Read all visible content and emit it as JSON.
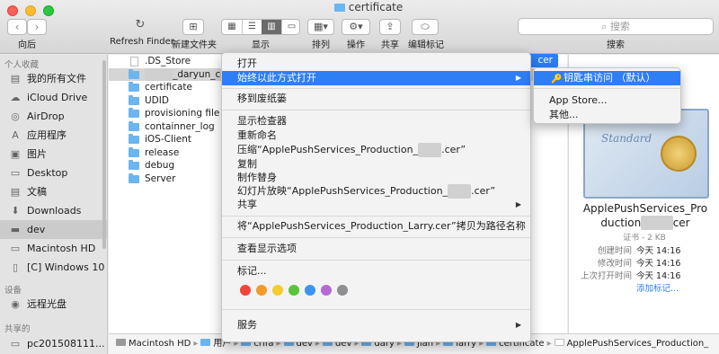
{
  "window": {
    "title": "certificate"
  },
  "toolbar": {
    "back_label": "向后",
    "refresh_label": "Refresh Finder",
    "newfolder_label": "新建文件夹",
    "view_label": "显示",
    "arrange_label": "排列",
    "action_label": "操作",
    "share_label": "共享",
    "tags_label": "编辑标记",
    "search_label": "搜索",
    "search_placeholder": "搜索"
  },
  "sidebar": {
    "personal_header": "个人收藏",
    "items": [
      {
        "label": "我的所有文件",
        "icon": "all-files-icon",
        "glyph": "▤"
      },
      {
        "label": "iCloud Drive",
        "icon": "cloud-icon",
        "glyph": "☁"
      },
      {
        "label": "AirDrop",
        "icon": "airdrop-icon",
        "glyph": "◎"
      },
      {
        "label": "应用程序",
        "icon": "applications-icon",
        "glyph": "A"
      },
      {
        "label": "图片",
        "icon": "pictures-icon",
        "glyph": "▣"
      },
      {
        "label": "Desktop",
        "icon": "desktop-icon",
        "glyph": "▭"
      },
      {
        "label": "文稿",
        "icon": "documents-icon",
        "glyph": "▤"
      },
      {
        "label": "Downloads",
        "icon": "downloads-icon",
        "glyph": "⬇"
      },
      {
        "label": "dev",
        "icon": "folder-icon",
        "glyph": "▬"
      },
      {
        "label": "Macintosh HD",
        "icon": "harddisk-icon",
        "glyph": "▭"
      },
      {
        "label": "[C] Windows 10",
        "icon": "windows-disk-icon",
        "glyph": "▯"
      }
    ],
    "devices_header": "设备",
    "devices": [
      {
        "label": "远程光盘",
        "icon": "remote-disc-icon",
        "glyph": "◉"
      }
    ],
    "shared_header": "共享的",
    "shared": [
      {
        "label": "pc201508111...",
        "icon": "computer-icon",
        "glyph": "▭"
      }
    ]
  },
  "files": {
    "rows": [
      {
        "name": ".DS_Store",
        "folder": false
      },
      {
        "name": "_daryun_com",
        "folder": true
      },
      {
        "name": "certificate",
        "folder": true
      },
      {
        "name": "UDID",
        "folder": true
      },
      {
        "name": "provisioning file",
        "folder": true
      },
      {
        "name": "containner_log",
        "folder": true
      },
      {
        "name": "iOS-Client",
        "folder": true
      },
      {
        "name": "release",
        "folder": true
      },
      {
        "name": "debug",
        "folder": true
      },
      {
        "name": "Server",
        "folder": true
      }
    ],
    "selected_suffix": "cer"
  },
  "context_menu": {
    "open": "打开",
    "open_with": "始终以此方式打开",
    "trash": "移到废纸篓",
    "get_info": "显示检查器",
    "rename": "重新命名",
    "compress": "压缩“ApplePushServices_Production_",
    "compress_end": ".cer”",
    "duplicate": "复制",
    "make_alias": "制作替身",
    "slideshow": "幻灯片放映“ApplePushServices_Production_",
    "slideshow_end": ".cer”",
    "share": "共享",
    "copy_path": "将“ApplePushServices_Production_Larry.cer”拷贝为路径名称",
    "view_options": "查看显示选项",
    "tags": "标记...",
    "services": "服务",
    "tag_colors": [
      "#f0453a",
      "#f39a2c",
      "#f5cb2e",
      "#5ac53a",
      "#3a95f0",
      "#b56ad3",
      "#8e8e93"
    ]
  },
  "submenu": {
    "keychain": "钥匙串访问 （默认）",
    "app_store": "App Store...",
    "other": "其他..."
  },
  "preview": {
    "filename_line1": "ApplePushServices_Pro",
    "filename_line2a": "duction",
    "filename_line2b": "cer",
    "kind": "证书 - 2 KB",
    "created_label": "创建时间",
    "created_value": "今天 14:16",
    "modified_label": "修改时间",
    "modified_value": "今天 14:16",
    "opened_label": "上次打开时间",
    "opened_value": "今天 14:16",
    "add_tags": "添加标记..."
  },
  "pathbar": {
    "items": [
      "Macintosh HD",
      "用户",
      "crifa",
      "dev",
      "dev",
      "dary",
      "Jian",
      "larry",
      "certificate",
      "ApplePushServices_Production_"
    ]
  },
  "colors": {
    "accent": "#2e7ef5",
    "folder": "#6bb5f0"
  }
}
